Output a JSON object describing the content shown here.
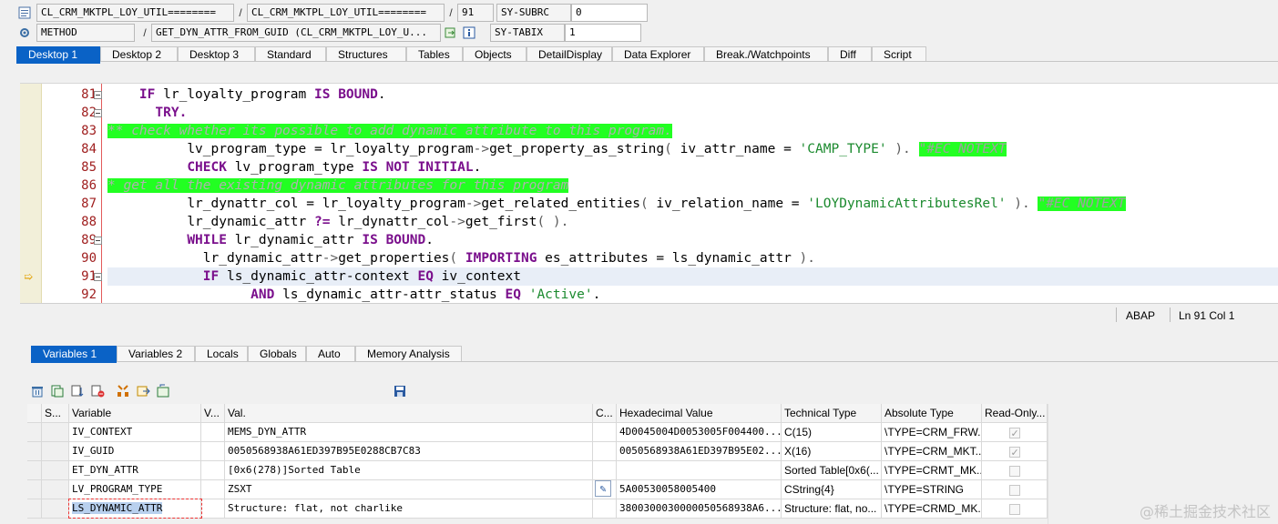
{
  "header": {
    "row1": {
      "program": "CL_CRM_MKTPL_LOY_UTIL========",
      "include": "CL_CRM_MKTPL_LOY_UTIL========",
      "line": "91",
      "field": "SY-SUBRC",
      "field_value": "0"
    },
    "row2": {
      "type": "METHOD",
      "method": "GET_DYN_ATTR_FROM_GUID (CL_CRM_MKTPL_LOY_U...",
      "field": "SY-TABIX",
      "field_value": "1"
    },
    "icons": [
      "program-icon",
      "method-icon",
      "navigate-icon",
      "info-icon"
    ]
  },
  "desktop_tabs": [
    "Desktop 1",
    "Desktop 2",
    "Desktop 3",
    "Standard",
    "Structures",
    "Tables",
    "Objects",
    "DetailDisplay",
    "Data Explorer",
    "Break./Watchpoints",
    "Diff",
    "Script"
  ],
  "editor": {
    "current_line": 91,
    "lines": [
      {
        "n": "81",
        "fold": true
      },
      {
        "n": "82",
        "fold": true
      },
      {
        "n": "83",
        "fold": false
      },
      {
        "n": "84",
        "fold": false
      },
      {
        "n": "85",
        "fold": false
      },
      {
        "n": "86",
        "fold": false
      },
      {
        "n": "87",
        "fold": false
      },
      {
        "n": "88",
        "fold": false
      },
      {
        "n": "89",
        "fold": true
      },
      {
        "n": "90",
        "fold": false
      },
      {
        "n": "91",
        "fold": true
      },
      {
        "n": "92",
        "fold": false
      }
    ],
    "code": {
      "l81_kw1": "IF",
      "l81_t1": " lr_loyalty_program ",
      "l81_kw2": "IS BOUND",
      "l81_t2": ".",
      "l82_kw": "TRY",
      "l83_cmt": "** check whether its possible to add dynamic attribute to this program.",
      "l84_t1": "lv_program_type = lr_loyalty_program",
      "l84_op": "->",
      "l84_t2": "get_property_as_string",
      "l84_op2": "(",
      "l84_t3": " iv_attr_name = ",
      "l84_str": "'CAMP_TYPE'",
      "l84_t4": " ",
      "l84_op3": ").",
      "l84_pragma": "\"#EC NOTEXT",
      "l85_kw1": "CHECK",
      "l85_t1": " lv_program_type ",
      "l85_kw2": "IS NOT INITIAL",
      "l85_t2": ".",
      "l86_cmt": "* get all the existing dynamic attributes for this program",
      "l87_t1": "lr_dynattr_col = lr_loyalty_program",
      "l87_op": "->",
      "l87_t2": "get_related_entities",
      "l87_op2": "(",
      "l87_t3": " iv_relation_name = ",
      "l87_str": "'LOYDynamicAttributesRel'",
      "l87_op3": " ).",
      "l87_pragma": "\"#EC NOTEXT",
      "l88_t1": "lr_dynamic_attr ",
      "l88_kw": "?=",
      "l88_t2": " lr_dynattr_col",
      "l88_op": "->",
      "l88_t3": "get_first",
      "l88_op2": "( ).",
      "l89_kw1": "WHILE",
      "l89_t1": " lr_dynamic_attr ",
      "l89_kw2": "IS BOUND",
      "l89_t2": ".",
      "l90_t1": "lr_dynamic_attr",
      "l90_op": "->",
      "l90_t2": "get_properties",
      "l90_op2": "(",
      "l90_kw": " IMPORTING",
      "l90_t3": " es_attributes = ls_dynamic_attr ",
      "l90_op3": ").",
      "l91_kw1": "IF",
      "l91_t1": " ls_dynamic_attr-context ",
      "l91_kw2": "EQ",
      "l91_t2": " iv_context",
      "l92_kw1": "AND",
      "l92_t1": " ls_dynamic_attr-attr_status ",
      "l92_kw2": "EQ",
      "l92_str": "'Active'",
      "l92_t2": "."
    }
  },
  "status": {
    "language": "ABAP",
    "position": "Ln  91 Col   1"
  },
  "variable_tabs": [
    "Variables 1",
    "Variables 2",
    "Locals",
    "Globals",
    "Auto",
    "Memory Analysis"
  ],
  "toolbar_icons": [
    "delete-icon",
    "copy-icon",
    "sort-icon",
    "remove-icon",
    "filter-icon",
    "export-icon",
    "settings-icon",
    "save-icon"
  ],
  "grid": {
    "headers": [
      "S...",
      "Variable",
      "V...",
      "Val.",
      "C...",
      "Hexadecimal Value",
      "Technical Type",
      "Absolute Type",
      "Read-Only..."
    ],
    "rows": [
      {
        "variable": "IV_CONTEXT",
        "value": "MEMS_DYN_ATTR",
        "hex": "4D0045004D0053005F004400...",
        "tech": "C(15)",
        "abs": "\\TYPE=CRM_FRW...",
        "ro": true
      },
      {
        "variable": "IV_GUID",
        "value": "0050568938A61ED397B95E0288CB7C83",
        "hex": "0050568938A61ED397B95E02...",
        "tech": "X(16)",
        "abs": "\\TYPE=CRM_MKT...",
        "ro": true
      },
      {
        "variable": "ET_DYN_ATTR",
        "value": "[0x6(278)]Sorted Table",
        "hex": "",
        "tech": "Sorted Table[0x6(...",
        "abs": "\\TYPE=CRMT_MK...",
        "ro": false
      },
      {
        "variable": "LV_PROGRAM_TYPE",
        "value": "ZSXT",
        "hex": "5A00530058005400",
        "tech": "CString{4}",
        "abs": "\\TYPE=STRING",
        "ro": false
      },
      {
        "variable": "LS_DYNAMIC_ATTR",
        "value": "Structure: flat, not charlike",
        "hex": "3800300030000050568938A6...",
        "tech": "Structure: flat, no...",
        "abs": "\\TYPE=CRMD_MK...",
        "ro": false
      }
    ]
  },
  "watermark": "@稀土掘金技术社区"
}
